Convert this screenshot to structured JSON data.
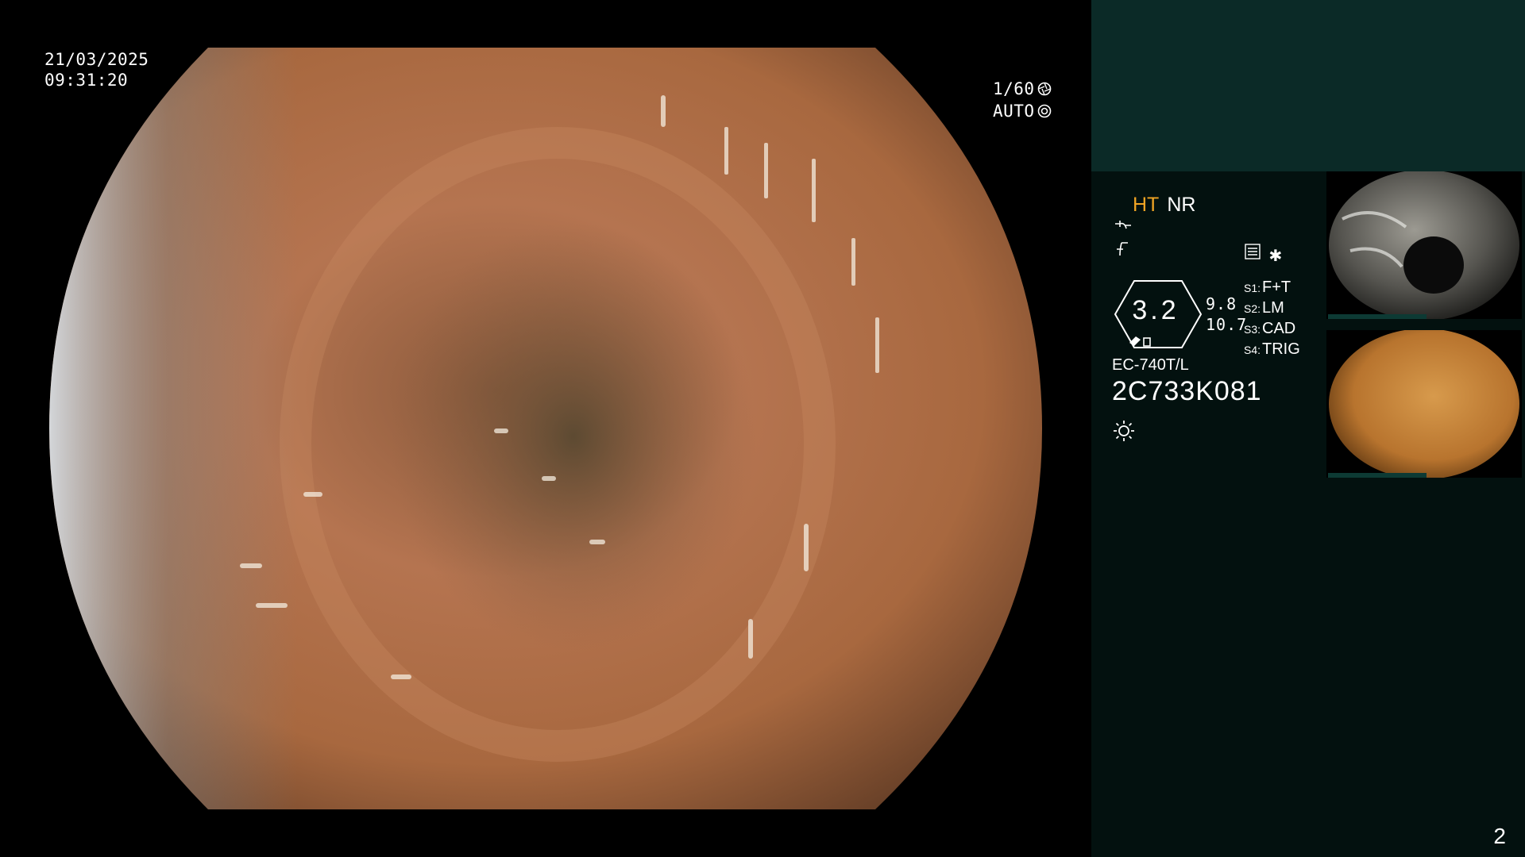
{
  "overlay": {
    "date": "21/03/2025",
    "time": "09:31:20",
    "shutter": "1/60",
    "exposure_mode": "AUTO"
  },
  "panel": {
    "mode_ht": "HT",
    "mode_nr": "NR",
    "zoom_value": "3.2",
    "mag_value_1": "9.8",
    "mag_value_2": "10.7",
    "switches": [
      {
        "key": "S1:",
        "value": "F+T"
      },
      {
        "key": "S2:",
        "value": "LM"
      },
      {
        "key": "S3:",
        "value": "CAD"
      },
      {
        "key": "S4:",
        "value": "TRIG"
      }
    ],
    "scope_model": "EC-740T/L",
    "serial_number": "2C733K081",
    "page_number": "2"
  },
  "icons": {
    "shutter": "aperture-icon",
    "exposure": "iris-icon",
    "scale": "scale-icon",
    "filter": "filter-icon",
    "menu": "menu-icon",
    "asterisk": "asterisk-icon",
    "light": "light-icon"
  },
  "colors": {
    "accent_ht": "#f0a424",
    "panel_bg": "#03110f",
    "panel_header": "#0b2a27",
    "mucosa": "#b07048"
  }
}
